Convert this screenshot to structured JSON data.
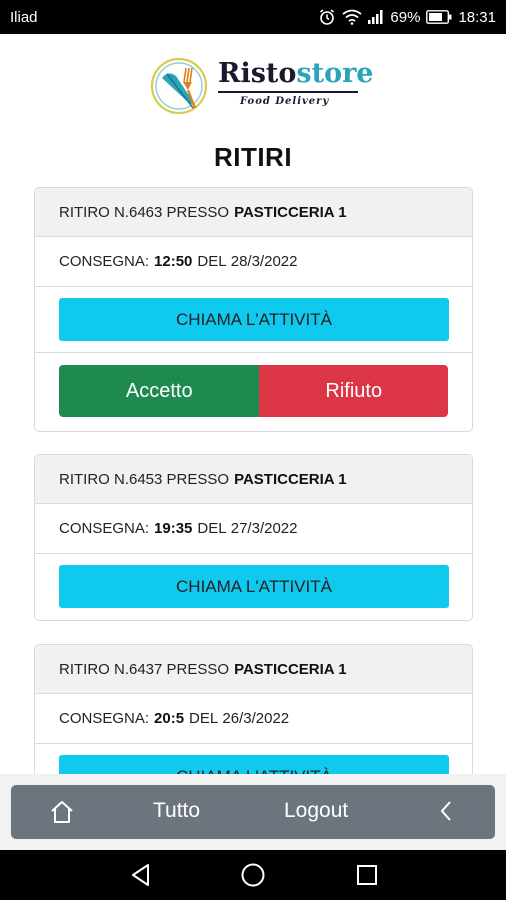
{
  "status_bar": {
    "carrier": "Iliad",
    "battery": "69%",
    "time": "18:31"
  },
  "brand": {
    "name_part1": "Risto",
    "name_part2": "store",
    "tagline": "Food Delivery",
    "color_main": "#1a1a2e",
    "color_accent": "#2ba3b8"
  },
  "page": {
    "title": "RITIRI"
  },
  "labels": {
    "pickup_prefix": "RITIRO N.",
    "at": "PRESSO",
    "delivery_prefix": "CONSEGNA:",
    "of": "DEL",
    "call_button": "CHIAMA L'ATTIVITÀ",
    "accept_button": "Accetto",
    "reject_button": "Rifiuto"
  },
  "orders": [
    {
      "number": "6463",
      "shop": "PASTICCERIA 1",
      "time": "12:50",
      "date": "28/3/2022"
    },
    {
      "number": "6453",
      "shop": "PASTICCERIA 1",
      "time": "19:35",
      "date": "27/3/2022"
    },
    {
      "number": "6437",
      "shop": "PASTICCERIA 1",
      "time": "20:5",
      "date": "26/3/2022"
    }
  ],
  "app_bar": {
    "home_icon": "home-icon",
    "all_label": "Tutto",
    "logout_label": "Logout",
    "back_icon": "chevron-left-icon"
  },
  "colors": {
    "call": "#10c9ef",
    "accept": "#1e8a4f",
    "reject": "#dc3545",
    "app_bar": "#6c757d"
  }
}
